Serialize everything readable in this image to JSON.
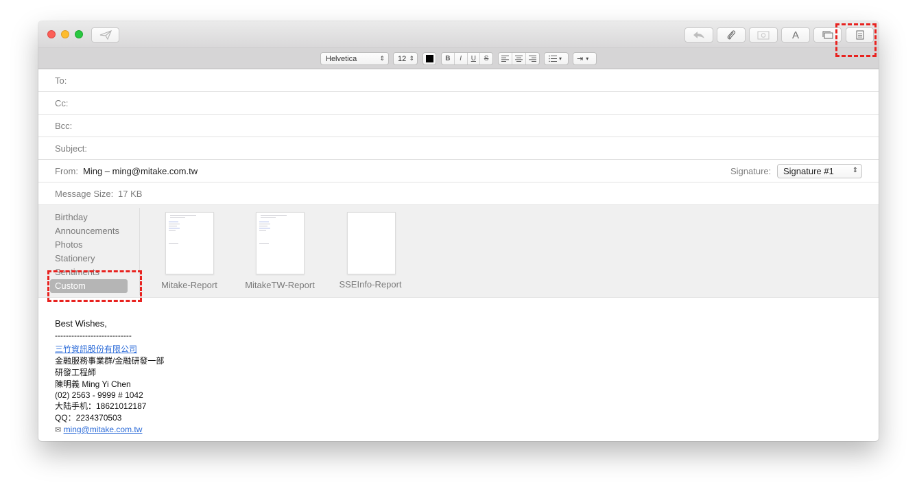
{
  "toolbar": {
    "send_icon": "paper-plane-icon",
    "buttons": [
      {
        "name": "reply-icon"
      },
      {
        "name": "paperclip-icon"
      },
      {
        "name": "photo-browser-icon"
      },
      {
        "name": "format-text-icon",
        "label": "A"
      },
      {
        "name": "show-photo-browser-icon"
      },
      {
        "name": "stationery-pane-icon"
      }
    ]
  },
  "format": {
    "font": "Helvetica",
    "size": "12",
    "color": "#000000",
    "bold": "B",
    "italic": "I",
    "underline": "U",
    "strike": "S"
  },
  "header": {
    "to_label": "To:",
    "cc_label": "Cc:",
    "bcc_label": "Bcc:",
    "subject_label": "Subject:",
    "from_label": "From:",
    "from_value": "Ming – ming@mitake.com.tw",
    "signature_label": "Signature:",
    "signature_value": "Signature #1",
    "size_label": "Message Size:",
    "size_value": "17 KB"
  },
  "stationery": {
    "categories": [
      "Birthday",
      "Announcements",
      "Photos",
      "Stationery",
      "Sentiments",
      "Custom"
    ],
    "selected": "Custom",
    "templates": [
      "Mitake-Report",
      "MitakeTW-Report",
      "SSEInfo-Report"
    ]
  },
  "signature_body": {
    "greeting": "Best Wishes,",
    "separator": "----------------------------",
    "company": "三竹資訊股份有限公司",
    "dept": "金融服務事業群/金融研發一部",
    "title": "研發工程師",
    "name": "陳明義 Ming Yi Chen",
    "phone": "(02) 2563 - 9999 # 1042",
    "mobile": "大陆手机：18621012187",
    "qq": "QQ：2234370503",
    "email_icon": "✉",
    "email": "ming@mitake.com.tw"
  },
  "highlight_color": "#e8221f"
}
